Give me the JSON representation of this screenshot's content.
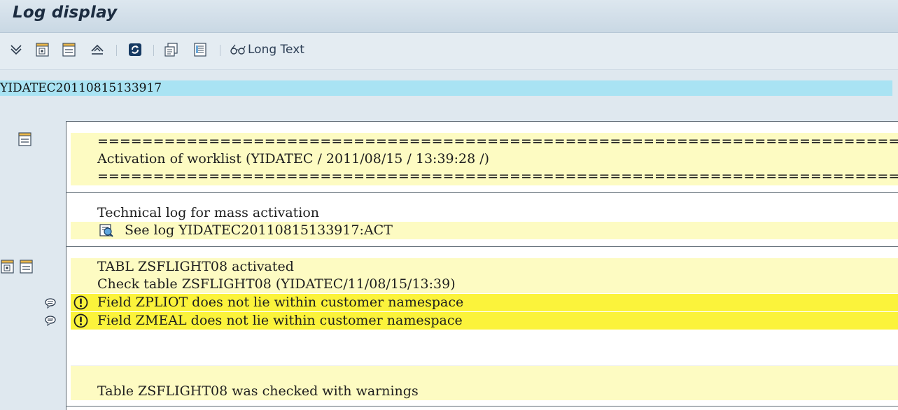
{
  "window": {
    "title": "Log display"
  },
  "toolbar": {
    "icons": [
      "expand-all-icon",
      "expand-icon",
      "collapse-icon",
      "collapse-all-icon",
      "refresh-icon",
      "print-icon",
      "list-icon",
      "glasses-icon"
    ],
    "long_text_label": "Long Text"
  },
  "log_id": "YIDATEC20110815133917",
  "sections": {
    "header": {
      "separator_top": "==========================================================================",
      "activation": "Activation of worklist (YIDATEC / 2011/08/15 / 13:39:28 /)",
      "separator_bottom": "=========================================================================="
    },
    "technical": {
      "title": "Technical log for mass activation",
      "see_log": "See log YIDATEC20110815133917:ACT"
    },
    "table": {
      "activated": "TABL ZSFLIGHT08 activated",
      "check": "Check table ZSFLIGHT08 (YIDATEC/11/08/15/13:39)",
      "warning1": "Field ZPLIOT does not lie within customer namespace",
      "warning2": "Field ZMEAL does not lie within customer namespace",
      "summary": "Table ZSFLIGHT08 was checked with warnings"
    }
  },
  "colors": {
    "log_id_bg": "#a9e3f3",
    "row_yellow": "#fdfbc2",
    "row_warning": "#fbf33b",
    "title_text": "#1c2c40"
  }
}
